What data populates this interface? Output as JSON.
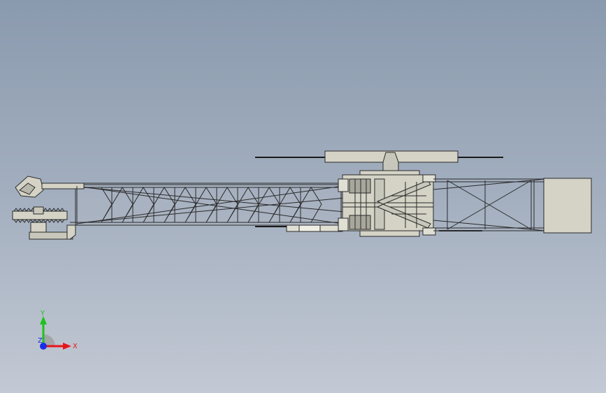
{
  "colors": {
    "background_top": "#8a9aae",
    "background_bottom": "#c3c9d4",
    "part_fill": "#d4d3c6",
    "part_shade": "#b8b7ab",
    "edge": "#2a2a2a",
    "axis_x": "#e8141a",
    "axis_y": "#1ec21e",
    "axis_z": "#1a2ee8"
  },
  "triad": {
    "x_label": "X",
    "y_label": "Y",
    "z_label": "Z"
  }
}
